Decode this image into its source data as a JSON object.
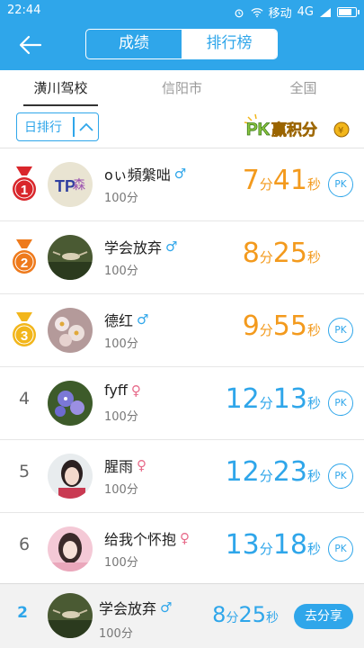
{
  "status_bar": {
    "time": "22:44",
    "carrier": "移动",
    "network": "4G",
    "icons": [
      "alarm-icon",
      "wifi-icon",
      "signal-icon",
      "battery-icon"
    ]
  },
  "header": {
    "segments": [
      "成绩",
      "排行榜"
    ],
    "selected": "排行榜"
  },
  "tabs": [
    {
      "label": "潢川驾校",
      "active": true
    },
    {
      "label": "信阳市",
      "active": false
    },
    {
      "label": "全国",
      "active": false
    }
  ],
  "filter": {
    "label": "日排行"
  },
  "pk_logo": {
    "text": "PK赢积分"
  },
  "rows": [
    {
      "rank": "1",
      "medal": "red",
      "name": "oぃ頻縏咄",
      "gender": "♂",
      "score": "100分",
      "min": "7",
      "min_unit": "分",
      "sec": "41",
      "sec_unit": "秒",
      "color": "#f39a1d",
      "pk": "PK"
    },
    {
      "rank": "2",
      "medal": "orange",
      "name": "学会放弃",
      "gender": "♂",
      "score": "100分",
      "min": "8",
      "min_unit": "分",
      "sec": "25",
      "sec_unit": "秒",
      "color": "#f39a1d",
      "pk": ""
    },
    {
      "rank": "3",
      "medal": "gold",
      "name": "德红",
      "gender": "♂",
      "score": "100分",
      "min": "9",
      "min_unit": "分",
      "sec": "55",
      "sec_unit": "秒",
      "color": "#f39a1d",
      "pk": "PK"
    },
    {
      "rank": "4",
      "medal": "",
      "name": "fyff",
      "gender": "♀",
      "score": "100分",
      "min": "12",
      "min_unit": "分",
      "sec": "13",
      "sec_unit": "秒",
      "color": "#2fa6ea",
      "pk": "PK"
    },
    {
      "rank": "5",
      "medal": "",
      "name": "腥雨",
      "gender": "♀",
      "score": "100分",
      "min": "12",
      "min_unit": "分",
      "sec": "23",
      "sec_unit": "秒",
      "color": "#2fa6ea",
      "pk": "PK"
    },
    {
      "rank": "6",
      "medal": "",
      "name": "给我个怀抱",
      "gender": "♀",
      "score": "100分",
      "min": "13",
      "min_unit": "分",
      "sec": "18",
      "sec_unit": "秒",
      "color": "#2fa6ea",
      "pk": "PK"
    }
  ],
  "footer": {
    "rank": "2",
    "name": "学会放弃",
    "gender": "♂",
    "score": "100分",
    "min": "8",
    "min_unit": "分",
    "sec": "25",
    "sec_unit": "秒",
    "share_label": "去分享"
  },
  "colors": {
    "primary": "#2fa6ea",
    "top3_time": "#f39a1d",
    "female": "#e76b8a",
    "medal_red": "#d9262b",
    "medal_orange": "#ee7a1c",
    "medal_gold": "#f2b61b"
  }
}
